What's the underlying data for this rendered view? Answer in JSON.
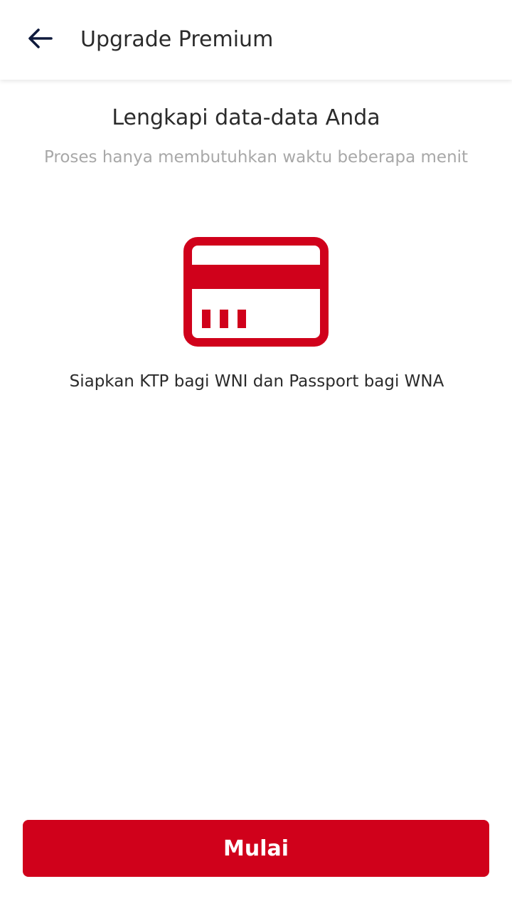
{
  "header": {
    "title": "Upgrade Premium",
    "back_icon": "arrow-left-icon"
  },
  "main": {
    "heading": "Lengkapi data-data Anda",
    "subheading": "Proses hanya membutuhkan waktu beberapa menit",
    "illustration_icon": "id-card-icon",
    "instruction": "Siapkan KTP bagi WNI dan Passport bagi WNA"
  },
  "footer": {
    "start_label": "Mulai"
  },
  "colors": {
    "accent": "#d0011b",
    "text_primary": "#2b2b2b",
    "text_secondary": "#a8a8a8",
    "back_arrow": "#0f1a3c"
  }
}
